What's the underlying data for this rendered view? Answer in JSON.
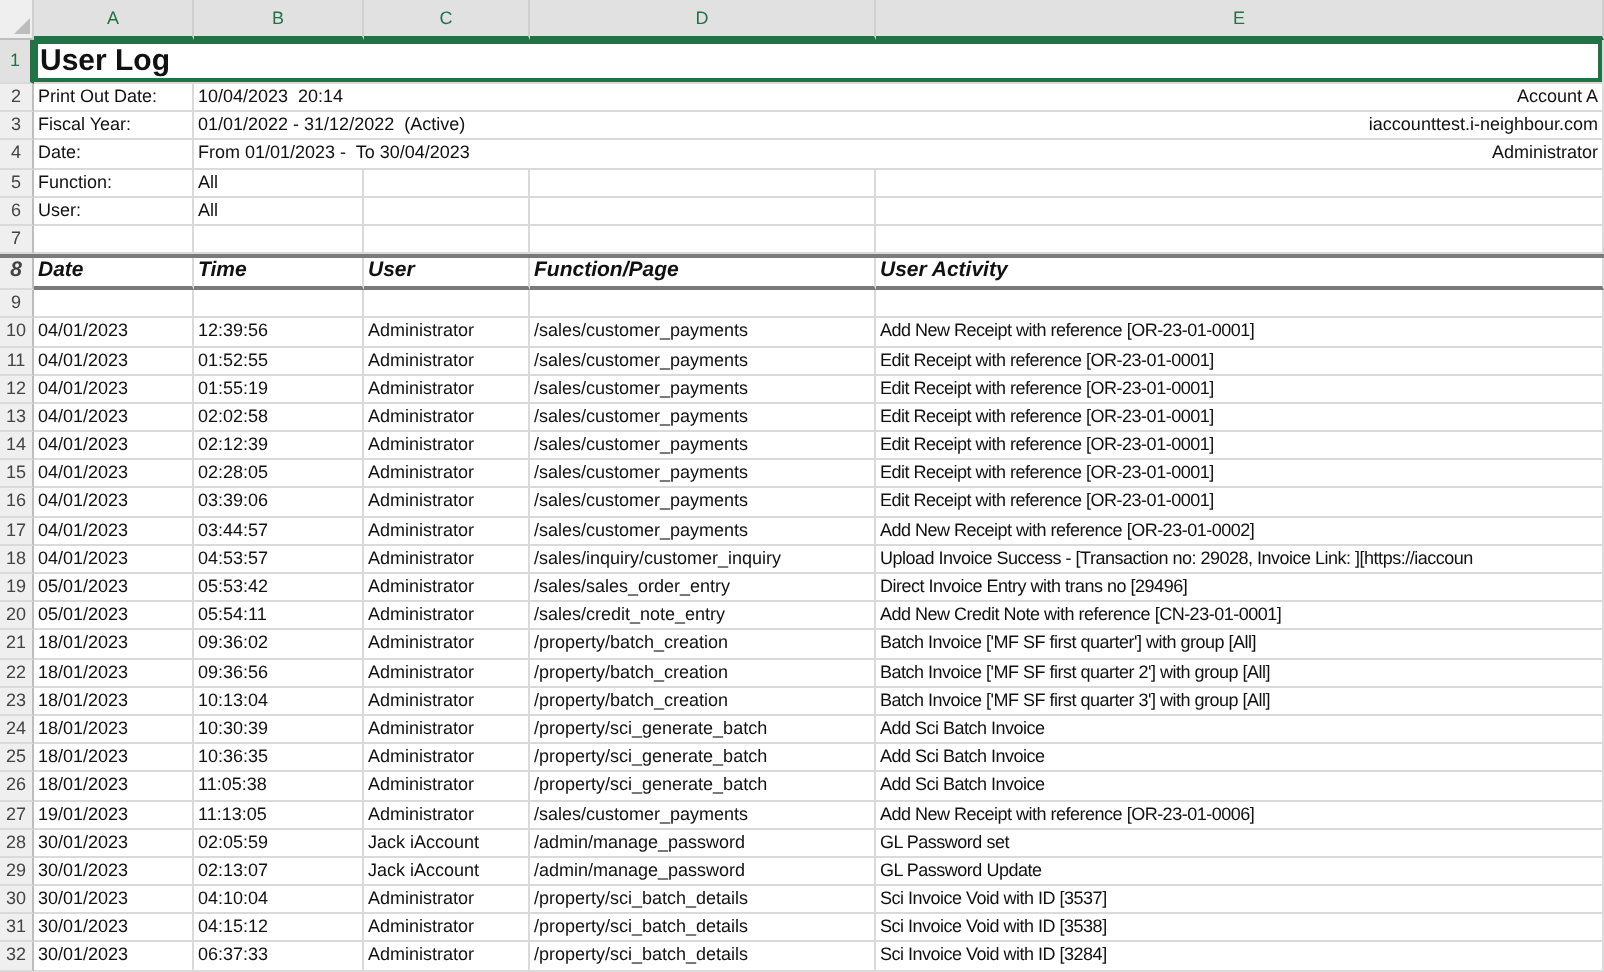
{
  "sheet": {
    "columns": [
      {
        "label": "A",
        "selected": true
      },
      {
        "label": "B",
        "selected": true
      },
      {
        "label": "C",
        "selected": true
      },
      {
        "label": "D",
        "selected": true
      },
      {
        "label": "E",
        "selected": true
      }
    ],
    "rows": [
      {
        "number": "1",
        "kind": "title",
        "selected": true,
        "text": "User Log"
      },
      {
        "number": "2",
        "kind": "info",
        "selected": false,
        "label": "Print Out Date:",
        "value": "10/04/2023  20:14",
        "right": "Account A"
      },
      {
        "number": "3",
        "kind": "info",
        "selected": false,
        "label": "Fiscal Year:",
        "value": "01/01/2022 - 31/12/2022  (Active)",
        "right": "iaccounttest.i-neighbour.com"
      },
      {
        "number": "4",
        "kind": "info",
        "selected": false,
        "label": "Date:",
        "value": "From 01/01/2023 -  To 30/04/2023",
        "right": "Administrator"
      },
      {
        "number": "5",
        "kind": "info",
        "selected": false,
        "label": "Function:",
        "value": "All"
      },
      {
        "number": "6",
        "kind": "info",
        "selected": false,
        "label": "User:",
        "value": "All"
      },
      {
        "number": "7",
        "kind": "blank",
        "selected": false
      },
      {
        "number": "8",
        "kind": "header",
        "selected": false,
        "cells": [
          "Date",
          "Time",
          "User",
          "Function/Page",
          "User Activity"
        ]
      },
      {
        "number": "9",
        "kind": "blank",
        "selected": false
      },
      {
        "number": "10",
        "kind": "data",
        "selected": false,
        "cells": [
          "04/01/2023",
          "12:39:56",
          "Administrator",
          "/sales/customer_payments",
          "Add New Receipt with reference [OR-23-01-0001]"
        ]
      },
      {
        "number": "11",
        "kind": "data",
        "selected": false,
        "cells": [
          "04/01/2023",
          "01:52:55",
          "Administrator",
          "/sales/customer_payments",
          "Edit Receipt with reference [OR-23-01-0001]"
        ]
      },
      {
        "number": "12",
        "kind": "data",
        "selected": false,
        "cells": [
          "04/01/2023",
          "01:55:19",
          "Administrator",
          "/sales/customer_payments",
          "Edit Receipt with reference [OR-23-01-0001]"
        ]
      },
      {
        "number": "13",
        "kind": "data",
        "selected": false,
        "cells": [
          "04/01/2023",
          "02:02:58",
          "Administrator",
          "/sales/customer_payments",
          "Edit Receipt with reference [OR-23-01-0001]"
        ]
      },
      {
        "number": "14",
        "kind": "data",
        "selected": false,
        "cells": [
          "04/01/2023",
          "02:12:39",
          "Administrator",
          "/sales/customer_payments",
          "Edit Receipt with reference [OR-23-01-0001]"
        ]
      },
      {
        "number": "15",
        "kind": "data",
        "selected": false,
        "cells": [
          "04/01/2023",
          "02:28:05",
          "Administrator",
          "/sales/customer_payments",
          "Edit Receipt with reference [OR-23-01-0001]"
        ]
      },
      {
        "number": "16",
        "kind": "data",
        "selected": false,
        "cells": [
          "04/01/2023",
          "03:39:06",
          "Administrator",
          "/sales/customer_payments",
          "Edit Receipt with reference [OR-23-01-0001]"
        ]
      },
      {
        "number": "17",
        "kind": "data",
        "selected": false,
        "cells": [
          "04/01/2023",
          "03:44:57",
          "Administrator",
          "/sales/customer_payments",
          "Add New Receipt with reference [OR-23-01-0002]"
        ]
      },
      {
        "number": "18",
        "kind": "data",
        "selected": false,
        "cells": [
          "04/01/2023",
          "04:53:57",
          "Administrator",
          "/sales/inquiry/customer_inquiry",
          "Upload Invoice Success - [Transaction no: 29028, Invoice Link: ][https://iaccoun"
        ]
      },
      {
        "number": "19",
        "kind": "data",
        "selected": false,
        "cells": [
          "05/01/2023",
          "05:53:42",
          "Administrator",
          "/sales/sales_order_entry",
          "Direct Invoice Entry with trans no [29496]"
        ]
      },
      {
        "number": "20",
        "kind": "data",
        "selected": false,
        "cells": [
          "05/01/2023",
          "05:54:11",
          "Administrator",
          "/sales/credit_note_entry",
          "Add New Credit Note with reference [CN-23-01-0001]"
        ]
      },
      {
        "number": "21",
        "kind": "data",
        "selected": false,
        "cells": [
          "18/01/2023",
          "09:36:02",
          "Administrator",
          "/property/batch_creation",
          "Batch Invoice ['MF SF first quarter'] with group [All]"
        ]
      },
      {
        "number": "22",
        "kind": "data",
        "selected": false,
        "cells": [
          "18/01/2023",
          "09:36:56",
          "Administrator",
          "/property/batch_creation",
          "Batch Invoice ['MF SF first quarter 2'] with group [All]"
        ]
      },
      {
        "number": "23",
        "kind": "data",
        "selected": false,
        "cells": [
          "18/01/2023",
          "10:13:04",
          "Administrator",
          "/property/batch_creation",
          "Batch Invoice ['MF SF first quarter 3'] with group [All]"
        ]
      },
      {
        "number": "24",
        "kind": "data",
        "selected": false,
        "cells": [
          "18/01/2023",
          "10:30:39",
          "Administrator",
          "/property/sci_generate_batch",
          "Add Sci Batch Invoice"
        ]
      },
      {
        "number": "25",
        "kind": "data",
        "selected": false,
        "cells": [
          "18/01/2023",
          "10:36:35",
          "Administrator",
          "/property/sci_generate_batch",
          "Add Sci Batch Invoice"
        ]
      },
      {
        "number": "26",
        "kind": "data",
        "selected": false,
        "cells": [
          "18/01/2023",
          "11:05:38",
          "Administrator",
          "/property/sci_generate_batch",
          "Add Sci Batch Invoice"
        ]
      },
      {
        "number": "27",
        "kind": "data",
        "selected": false,
        "cells": [
          "19/01/2023",
          "11:13:05",
          "Administrator",
          "/sales/customer_payments",
          "Add New Receipt with reference [OR-23-01-0006]"
        ]
      },
      {
        "number": "28",
        "kind": "data",
        "selected": false,
        "cells": [
          "30/01/2023",
          "02:05:59",
          "Jack iAccount",
          "/admin/manage_password",
          "GL Password set"
        ]
      },
      {
        "number": "29",
        "kind": "data",
        "selected": false,
        "cells": [
          "30/01/2023",
          "02:13:07",
          "Jack iAccount",
          "/admin/manage_password",
          "GL Password Update"
        ]
      },
      {
        "number": "30",
        "kind": "data",
        "selected": false,
        "cells": [
          "30/01/2023",
          "04:10:04",
          "Administrator",
          "/property/sci_batch_details",
          "Sci Invoice Void with ID [3537]"
        ]
      },
      {
        "number": "31",
        "kind": "data",
        "selected": false,
        "cells": [
          "30/01/2023",
          "04:15:12",
          "Administrator",
          "/property/sci_batch_details",
          "Sci Invoice Void with ID [3538]"
        ]
      },
      {
        "number": "32",
        "kind": "data",
        "selected": false,
        "cells": [
          "30/01/2023",
          "06:37:33",
          "Administrator",
          "/property/sci_batch_details",
          "Sci Invoice Void with ID [3284]"
        ]
      }
    ]
  }
}
